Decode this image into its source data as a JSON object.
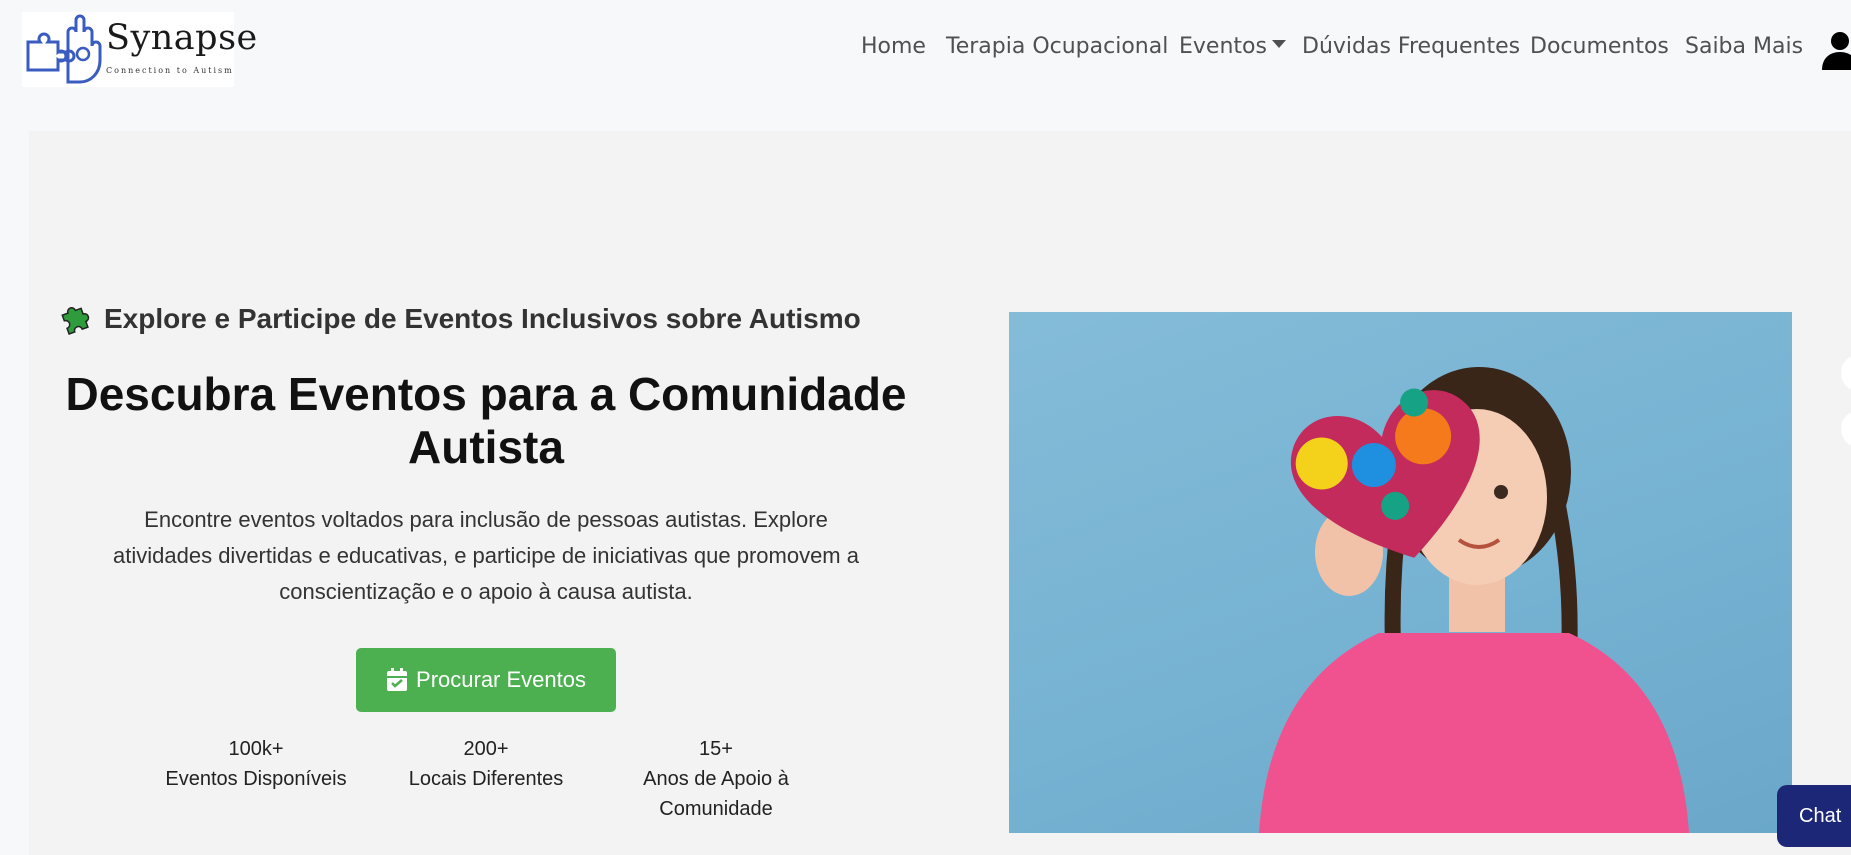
{
  "brand": {
    "name": "Synapse",
    "tagline": "Connection to Autism"
  },
  "nav": {
    "items": [
      {
        "label": "Home"
      },
      {
        "label": "Terapia Ocupacional"
      },
      {
        "label": "Eventos"
      },
      {
        "label": "Dúvidas Frequentes"
      },
      {
        "label": "Documentos"
      },
      {
        "label": "Saiba Mais"
      }
    ]
  },
  "hero": {
    "kicker": "Explore e Participe de Eventos Inclusivos sobre Autismo",
    "headline": "Descubra Eventos para a Comunidade Autista",
    "description": "Encontre eventos voltados para inclusão de pessoas autistas. Explore atividades divertidas e educativas, e participe de iniciativas que promovem a conscientização e o apoio à causa autista.",
    "cta_label": "Procurar Eventos",
    "stats": [
      {
        "value": "100k+",
        "label": "Eventos Disponíveis"
      },
      {
        "value": "200+",
        "label": "Locais Diferentes"
      },
      {
        "value": "15+",
        "label": "Anos de Apoio à Comunidade"
      }
    ]
  },
  "chat": {
    "label": "Chat"
  },
  "colors": {
    "cta": "#4caf50",
    "chat": "#1d2777",
    "logo_blue": "#3a5bbf",
    "image_bg": "#7ab6d4",
    "shirt": "#f0528f"
  },
  "icons": [
    "puzzle-piece-icon",
    "calendar-check-icon",
    "user-icon",
    "caret-down-icon"
  ]
}
